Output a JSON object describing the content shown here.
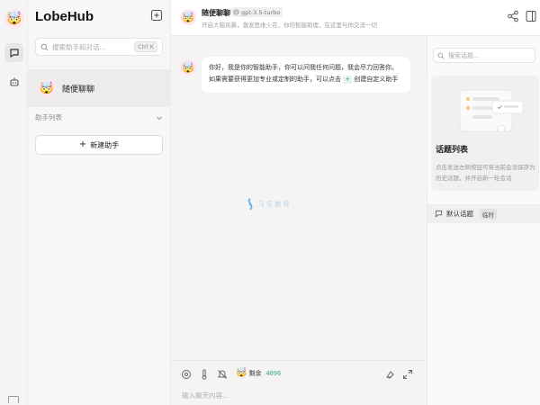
{
  "app": {
    "brand": "LobeHub",
    "avatar_emoji": "🤯"
  },
  "sidebar": {
    "search_placeholder": "搜索助手和对话...",
    "search_shortcut": "Ctrl K",
    "sessions": [
      {
        "name": "随便聊聊",
        "emoji": "🤯"
      }
    ],
    "group_label": "助手列表",
    "add_assistant_label": "新建助手"
  },
  "header": {
    "title": "随便聊聊",
    "model": "gpt-3.5-turbo",
    "description": "开启大脑风暴，激发思维火花，你的智能助理，在这里与你交流一切"
  },
  "chat": {
    "greeting_part1": "你好，我是你的智能助手，你可以问我任何问题，我会尽力回答你。如果需要获得更加专业或定制的助手，可以点击",
    "inline_button": "+",
    "greeting_part2": "创建自定义助手",
    "watermark": "马 乐 教 程"
  },
  "input": {
    "token_label": "剩余",
    "token_value": "4096",
    "placeholder": "输入聊天内容..."
  },
  "topics": {
    "search_placeholder": "搜索话题...",
    "empty_title": "话题列表",
    "empty_desc": "点击发送左侧按钮可将当前会话保存为历史话题，并开启新一轮会话",
    "default_topic": "默认话题",
    "default_tag": "临时"
  },
  "colors": {
    "accent_green": "#3aa76d",
    "avatar_bg": "#fde7ee"
  }
}
